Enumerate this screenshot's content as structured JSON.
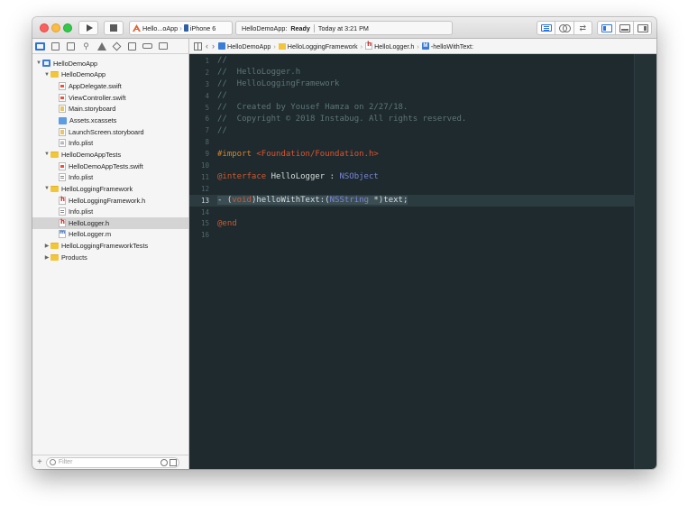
{
  "toolbar": {
    "scheme": {
      "target": "Hello...oApp",
      "device": "iPhone 6"
    },
    "activity": {
      "project": "HelloDemoApp:",
      "status": "Ready",
      "time": "Today at 3:21 PM"
    }
  },
  "navigator": {
    "filter_placeholder": "Filter",
    "tree": [
      {
        "label": "HelloDemoApp",
        "icon": "project-icon",
        "indent": 0,
        "disclosure": "▼"
      },
      {
        "label": "HelloDemoApp",
        "icon": "folder-icon",
        "indent": 1,
        "disclosure": "▼"
      },
      {
        "label": "AppDelegate.swift",
        "icon": "swift-file-icon",
        "indent": 2,
        "disclosure": ""
      },
      {
        "label": "ViewController.swift",
        "icon": "swift-file-icon",
        "indent": 2,
        "disclosure": ""
      },
      {
        "label": "Main.storyboard",
        "icon": "storyboard-file-icon",
        "indent": 2,
        "disclosure": ""
      },
      {
        "label": "Assets.xcassets",
        "icon": "asset-catalog-icon",
        "indent": 2,
        "disclosure": ""
      },
      {
        "label": "LaunchScreen.storyboard",
        "icon": "storyboard-file-icon",
        "indent": 2,
        "disclosure": ""
      },
      {
        "label": "Info.plist",
        "icon": "plist-file-icon",
        "indent": 2,
        "disclosure": ""
      },
      {
        "label": "HelloDemoAppTests",
        "icon": "folder-icon",
        "indent": 1,
        "disclosure": "▼"
      },
      {
        "label": "HelloDemoAppTests.swift",
        "icon": "swift-file-icon",
        "indent": 2,
        "disclosure": ""
      },
      {
        "label": "Info.plist",
        "icon": "plist-file-icon",
        "indent": 2,
        "disclosure": ""
      },
      {
        "label": "HelloLoggingFramework",
        "icon": "folder-icon",
        "indent": 1,
        "disclosure": "▼"
      },
      {
        "label": "HelloLoggingFramework.h",
        "icon": "header-file-icon",
        "indent": 2,
        "disclosure": ""
      },
      {
        "label": "Info.plist",
        "icon": "plist-file-icon",
        "indent": 2,
        "disclosure": ""
      },
      {
        "label": "HelloLogger.h",
        "icon": "header-file-icon",
        "indent": 2,
        "disclosure": "",
        "selected": true
      },
      {
        "label": "HelloLogger.m",
        "icon": "implementation-file-icon",
        "indent": 2,
        "disclosure": ""
      },
      {
        "label": "HelloLoggingFrameworkTests",
        "icon": "folder-icon",
        "indent": 1,
        "disclosure": "▶"
      },
      {
        "label": "Products",
        "icon": "folder-icon",
        "indent": 1,
        "disclosure": "▶"
      }
    ]
  },
  "jump_bar": {
    "crumbs": [
      {
        "label": "HelloDemoApp",
        "icon": "project-icon"
      },
      {
        "label": "HelloLoggingFramework",
        "icon": "folder-icon"
      },
      {
        "label": "HelloLogger.h",
        "icon": "header-file-icon"
      },
      {
        "label": "-helloWithText:",
        "icon": "method-icon"
      }
    ]
  },
  "editor": {
    "current_line": 13,
    "lines": [
      {
        "n": "1",
        "tokens": [
          [
            "comment",
            "//"
          ]
        ]
      },
      {
        "n": "2",
        "tokens": [
          [
            "comment",
            "//  HelloLogger.h"
          ]
        ]
      },
      {
        "n": "3",
        "tokens": [
          [
            "comment",
            "//  HelloLoggingFramework"
          ]
        ]
      },
      {
        "n": "4",
        "tokens": [
          [
            "comment",
            "//"
          ]
        ]
      },
      {
        "n": "5",
        "tokens": [
          [
            "comment",
            "//  Created by Yousef Hamza on 2/27/18."
          ]
        ]
      },
      {
        "n": "6",
        "tokens": [
          [
            "comment",
            "//  Copyright © 2018 Instabug. All rights reserved."
          ]
        ]
      },
      {
        "n": "7",
        "tokens": [
          [
            "comment",
            "//"
          ]
        ]
      },
      {
        "n": "8",
        "tokens": []
      },
      {
        "n": "9",
        "tokens": [
          [
            "pp",
            "#import "
          ],
          [
            "str",
            "<Foundation/Foundation.h>"
          ]
        ]
      },
      {
        "n": "10",
        "tokens": []
      },
      {
        "n": "11",
        "tokens": [
          [
            "kw",
            "@interface"
          ],
          [
            "plain",
            " HelloLogger : "
          ],
          [
            "type",
            "NSObject"
          ]
        ]
      },
      {
        "n": "12",
        "tokens": []
      },
      {
        "n": "13",
        "tokens": [
          [
            "sel",
            "- "
          ],
          [
            "sel-plain",
            "("
          ],
          [
            "sel-kw",
            "void"
          ],
          [
            "sel-plain",
            ")helloWithText:("
          ],
          [
            "sel-type",
            "NSString"
          ],
          [
            "sel-plain",
            " *)text;"
          ]
        ]
      },
      {
        "n": "14",
        "tokens": []
      },
      {
        "n": "15",
        "tokens": [
          [
            "kw",
            "@end"
          ]
        ]
      },
      {
        "n": "16",
        "tokens": []
      }
    ]
  },
  "colors": {
    "editor_background": "#1e2a2d",
    "comment": "#5f7578",
    "preprocessor": "#d8842b",
    "string": "#dc5531",
    "keyword": "#cc5a34",
    "type": "#7a86d8",
    "accent": "#2c74dc"
  }
}
